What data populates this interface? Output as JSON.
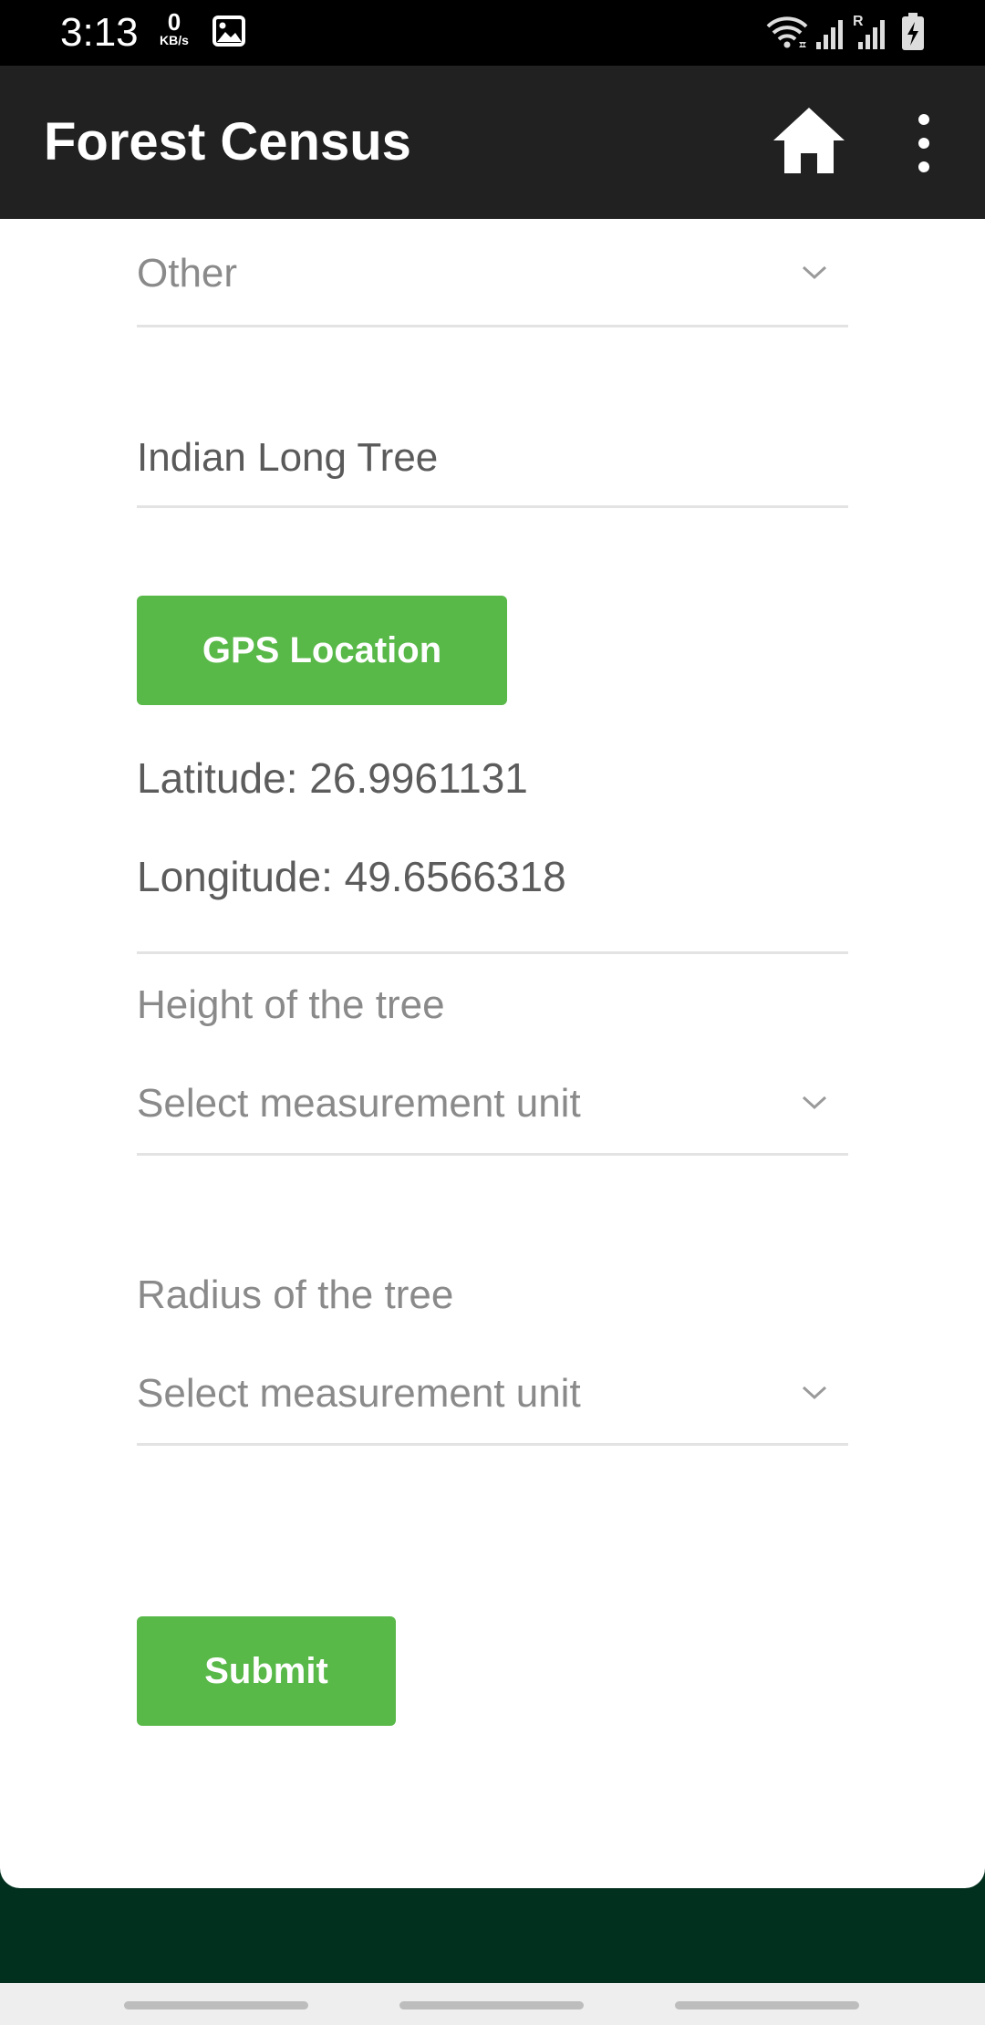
{
  "status_bar": {
    "time": "3:13",
    "net_speed_value": "0",
    "net_speed_unit": "KB/s",
    "roaming_indicator": "R"
  },
  "app_bar": {
    "title": "Forest Census",
    "icons": [
      "home-icon",
      "overflow-menu-icon"
    ]
  },
  "form": {
    "tree_type_select": {
      "value": "Other"
    },
    "tree_name_input": {
      "value": "Indian Long Tree"
    },
    "gps_button_label": "GPS Location",
    "latitude_text": "Latitude: 26.9961131",
    "longitude_text": "Longitude: 49.6566318",
    "height": {
      "label": "Height of the tree",
      "unit_select": "Select measurement unit"
    },
    "radius": {
      "label": "Radius of the tree",
      "unit_select": "Select measurement unit"
    },
    "submit_label": "Submit"
  },
  "colors": {
    "app_bar": "#212121",
    "accent_button": "#58b848",
    "background_dark_green": "#02301e"
  }
}
